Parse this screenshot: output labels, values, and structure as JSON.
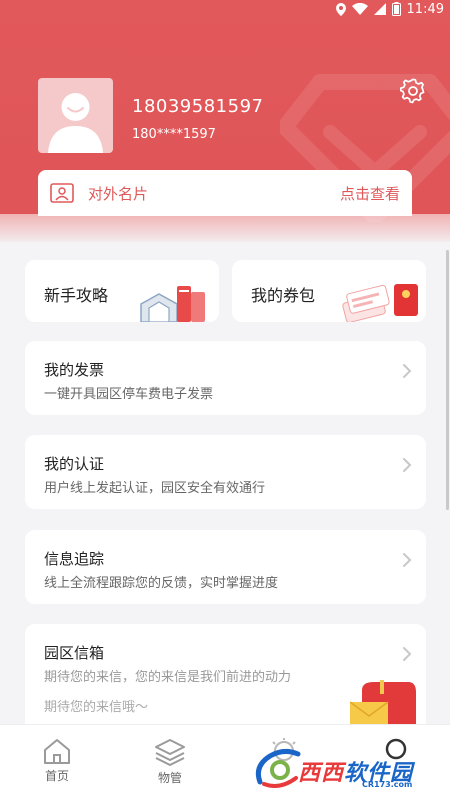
{
  "status_bar": {
    "time": "11:49"
  },
  "profile": {
    "phone": "18039581597",
    "phone_masked": "180****1597"
  },
  "namecard": {
    "label": "对外名片",
    "action": "点击查看"
  },
  "quick_links": [
    {
      "label": "新手攻略"
    },
    {
      "label": "我的券包"
    }
  ],
  "cards": [
    {
      "title": "我的发票",
      "desc": "一键开具园区停车费电子发票"
    },
    {
      "title": "我的认证",
      "desc": "用户线上发起认证，园区安全有效通行"
    },
    {
      "title": "信息追踪",
      "desc": "线上全流程跟踪您的反馈，实时掌握进度"
    },
    {
      "title": "园区信箱",
      "desc": "期待您的来信，您的来信是我们前进的动力",
      "desc2": "期待您的来信哦～"
    }
  ],
  "tabbar": [
    {
      "label": "首页",
      "icon": "home-icon"
    },
    {
      "label": "物管",
      "icon": "layers-icon"
    },
    {
      "label": "",
      "icon": "bulb-icon"
    },
    {
      "label": "",
      "icon": "user-icon"
    }
  ],
  "watermark_logo": {
    "text_main": "西西",
    "text_accent": "软件园",
    "sub": "CR173.com"
  },
  "colors": {
    "brand_red": "#e0585a",
    "bg": "#f4f4f6"
  }
}
